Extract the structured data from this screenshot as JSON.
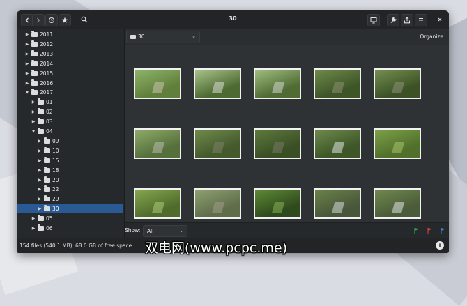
{
  "window": {
    "title": "30",
    "icons": [
      "back-arrow-icon",
      "forward-arrow-icon",
      "history-icon",
      "star-icon",
      "search-icon",
      "present-icon",
      "wrench-icon",
      "share-icon",
      "hamburger-menu-icon",
      "close-icon"
    ]
  },
  "sidebar": {
    "items": [
      {
        "label": "2011",
        "level": 0,
        "expanded": false,
        "selected": false
      },
      {
        "label": "2012",
        "level": 0,
        "expanded": false,
        "selected": false
      },
      {
        "label": "2013",
        "level": 0,
        "expanded": false,
        "selected": false
      },
      {
        "label": "2014",
        "level": 0,
        "expanded": false,
        "selected": false
      },
      {
        "label": "2015",
        "level": 0,
        "expanded": false,
        "selected": false
      },
      {
        "label": "2016",
        "level": 0,
        "expanded": false,
        "selected": false
      },
      {
        "label": "2017",
        "level": 0,
        "expanded": true,
        "selected": false
      },
      {
        "label": "01",
        "level": 1,
        "expanded": false,
        "selected": false
      },
      {
        "label": "02",
        "level": 1,
        "expanded": false,
        "selected": false
      },
      {
        "label": "03",
        "level": 1,
        "expanded": false,
        "selected": false
      },
      {
        "label": "04",
        "level": 1,
        "expanded": true,
        "selected": false
      },
      {
        "label": "09",
        "level": 2,
        "expanded": false,
        "selected": false
      },
      {
        "label": "10",
        "level": 2,
        "expanded": false,
        "selected": false
      },
      {
        "label": "15",
        "level": 2,
        "expanded": false,
        "selected": false
      },
      {
        "label": "18",
        "level": 2,
        "expanded": false,
        "selected": false
      },
      {
        "label": "20",
        "level": 2,
        "expanded": false,
        "selected": false
      },
      {
        "label": "22",
        "level": 2,
        "expanded": false,
        "selected": false
      },
      {
        "label": "29",
        "level": 2,
        "expanded": false,
        "selected": false
      },
      {
        "label": "30",
        "level": 2,
        "expanded": false,
        "selected": true
      },
      {
        "label": "05",
        "level": 1,
        "expanded": false,
        "selected": false
      },
      {
        "label": "06",
        "level": 1,
        "expanded": false,
        "selected": false
      }
    ]
  },
  "pathbar": {
    "current_folder": "30",
    "organize_label": "Organize"
  },
  "thumbnails": [
    {
      "name": "forest-path",
      "sky": "#8fb46a",
      "ground": "#5f7f3a",
      "accent": "#c9c4b0"
    },
    {
      "name": "waterfall-trail",
      "sky": "#a9c48a",
      "ground": "#4d6a33",
      "accent": "#d9dcd4"
    },
    {
      "name": "waterfall-trail-2",
      "sky": "#9fbe80",
      "ground": "#506b34",
      "accent": "#d4d6cf"
    },
    {
      "name": "dense-woods",
      "sky": "#6e8a4a",
      "ground": "#3e5528",
      "accent": "#8a8f74"
    },
    {
      "name": "dense-woods-2",
      "sky": "#758f50",
      "ground": "#3c5226",
      "accent": "#8d9278"
    },
    {
      "name": "trail-sign",
      "sky": "#8eab6a",
      "ground": "#56703b",
      "accent": "#b9b9ae"
    },
    {
      "name": "tree-trunks",
      "sky": "#6f8a4b",
      "ground": "#44592c",
      "accent": "#7d7f6a"
    },
    {
      "name": "mossy-rocks",
      "sky": "#5e7a3e",
      "ground": "#3a4f24",
      "accent": "#777a66"
    },
    {
      "name": "cascade",
      "sky": "#6d8a4c",
      "ground": "#3e5628",
      "accent": "#dfe4e4"
    },
    {
      "name": "moss-ledge",
      "sky": "#7da048",
      "ground": "#50702c",
      "accent": "#a7c36a"
    },
    {
      "name": "moss-wall",
      "sky": "#86a64f",
      "ground": "#4f6c2c",
      "accent": "#b1c978"
    },
    {
      "name": "stone-steps",
      "sky": "#8da171",
      "ground": "#5f6d4a",
      "accent": "#a19d88"
    },
    {
      "name": "green-canopy",
      "sky": "#5e8a35",
      "ground": "#2f4a1d",
      "accent": "#86b05a"
    },
    {
      "name": "river-rocks",
      "sky": "#6a8249",
      "ground": "#48573a",
      "accent": "#d5dad8"
    },
    {
      "name": "river-falls",
      "sky": "#71884f",
      "ground": "#4a5c39",
      "accent": "#dfe3e2"
    }
  ],
  "showbar": {
    "label": "Show:",
    "selected_option": "All",
    "flags": [
      {
        "name": "green-flag-icon",
        "color": "#3fae49"
      },
      {
        "name": "red-flag-icon",
        "color": "#d9413a"
      },
      {
        "name": "blue-flag-icon",
        "color": "#3d7fd6"
      }
    ]
  },
  "statusbar": {
    "files": "154 files (540.1 MB)",
    "free_space": "68.0 GB of free space",
    "info_glyph": "i"
  },
  "watermark": {
    "text": "双电网(www.pcpc.me)"
  }
}
